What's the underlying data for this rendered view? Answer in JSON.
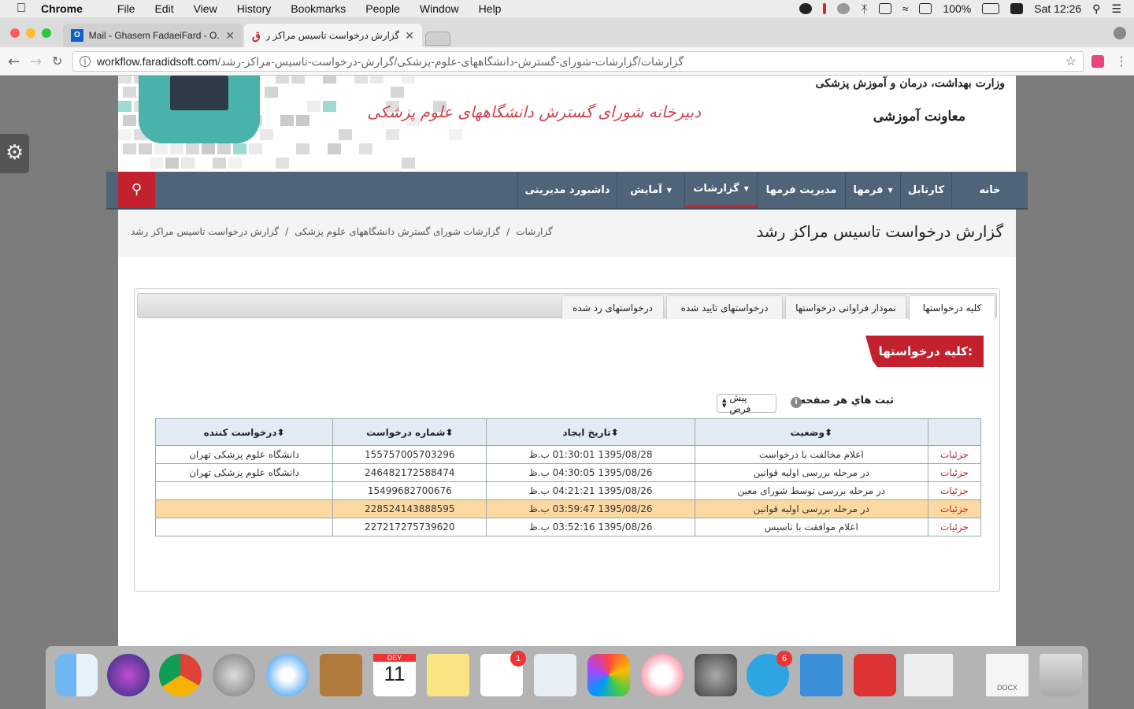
{
  "menubar": {
    "app": "Chrome",
    "items": [
      "File",
      "Edit",
      "View",
      "History",
      "Bookmarks",
      "People",
      "Window",
      "Help"
    ],
    "battery": "100%",
    "clock": "Sat 12:26"
  },
  "browser": {
    "tabs": [
      {
        "title": "Mail - Ghasem FadaeiFard - O..."
      },
      {
        "title": "گزارش درخواست تاسیس مراکز رشد"
      }
    ],
    "url_host": "workflow.faradidsoft.com",
    "url_path": "/گزارشات/گزارشات-شورای-گسترش-دانشگاههای-علوم-پزشکی/گزارش-درخواست-تاسیس-مراکز-رشد"
  },
  "header": {
    "ministry_line1": "وزارت بهداشت، درمان و آموزش پزشکی",
    "ministry_line2": "معاونت آموزشی",
    "secretariat": "دبیرخانه شورای گسترش دانشگاههای علوم پزشکی"
  },
  "nav": {
    "items": [
      {
        "label": "خانه"
      },
      {
        "label": "کارتابل"
      },
      {
        "label": "فرمها"
      },
      {
        "label": "مدیریت فرمها"
      },
      {
        "label": "گزارشات"
      },
      {
        "label": "آمایش"
      },
      {
        "label": "داشبورد مدیریتی"
      }
    ]
  },
  "page": {
    "title": "گزارش درخواست تاسیس مراکز رشد",
    "breadcrumb": [
      "گزارشات",
      "گزارشات شورای گسترش دانشگاههای علوم پزشکی",
      "گزارش درخواست تاسیس مراکز رشد"
    ],
    "breadcrumb_sep": "/"
  },
  "panel": {
    "tabs": [
      "کلیه درخواستها",
      "نمودار فراوانی درخواستها",
      "درخواستهای تایید شده",
      "درخواستهای رد شده"
    ],
    "section_title": "کلیه درخواستها:",
    "per_page_label": "ثبت هاي هر صفحه",
    "per_page_value": "پيش فرض",
    "columns": [
      "وضعیت",
      "تاریخ ایجاد",
      "شماره درخواست",
      "درخواست کننده"
    ],
    "rows": [
      {
        "link": "جزئیات",
        "status": "اعلام مخالفت با درخواست",
        "date": "1395/08/28 01:30:01 ب.ظ",
        "number": "155757005703296",
        "requester": "دانشگاه علوم پزشکی تهران"
      },
      {
        "link": "جزئیات",
        "status": "در مرحله بررسی اولیه قوانین",
        "date": "1395/08/26 04:30:05 ب.ظ",
        "number": "246482172588474",
        "requester": "دانشگاه علوم پزشکی تهران"
      },
      {
        "link": "جزئیات",
        "status": "در مرحله بررسی توسط شورای معین",
        "date": "1395/08/26 04:21:21 ب.ظ",
        "number": "15499682700676",
        "requester": ""
      },
      {
        "link": "جزئیات",
        "status": "در مرحله بررسی اولیه قوانین",
        "date": "1395/08/26 03:59:47 ب.ظ",
        "number": "228524143888595",
        "requester": ""
      },
      {
        "link": "جزئیات",
        "status": "اعلام موافقت با تاسیس",
        "date": "1395/08/26 03:52:16 ب.ظ",
        "number": "227217275739620",
        "requester": ""
      }
    ]
  },
  "dock": {
    "calendar_month": "DEY",
    "calendar_day": "11",
    "reminders_badge": "1",
    "telegram_badge": "6",
    "docx_label": "DOCX"
  }
}
